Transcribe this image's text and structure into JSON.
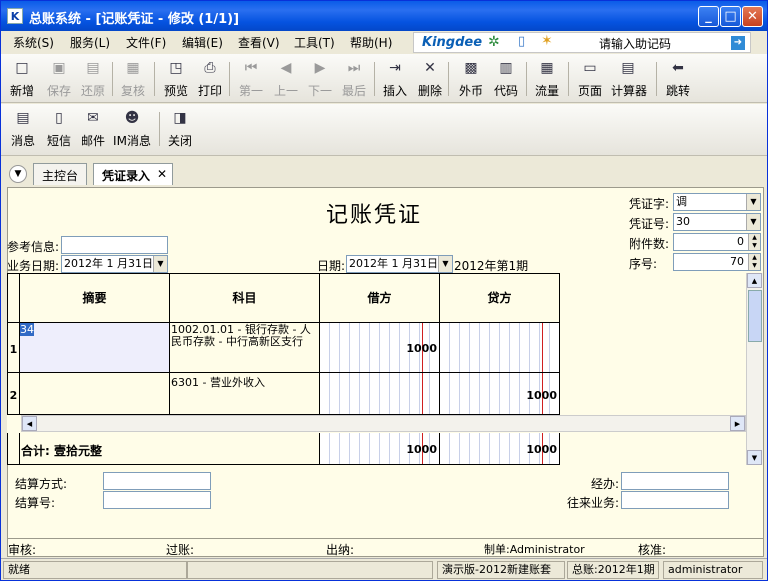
{
  "window": {
    "icon": "K",
    "title": "总账系统 - [记账凭证 - 修改 (1/1)]"
  },
  "menu": [
    "系统(S)",
    "服务(L)",
    "文件(F)",
    "编辑(E)",
    "查看(V)",
    "工具(T)",
    "帮助(H)"
  ],
  "brand": {
    "logo": "Kingdee",
    "hint": "请输入助记码"
  },
  "toolbar1": [
    {
      "label": "新增",
      "icon": "□",
      "enabled": true
    },
    {
      "label": "保存",
      "icon": "▣",
      "enabled": false
    },
    {
      "label": "还原",
      "icon": "▤",
      "enabled": false
    },
    {
      "label": "复核",
      "icon": "▦",
      "enabled": false
    },
    {
      "label": "预览",
      "icon": "◳",
      "enabled": true
    },
    {
      "label": "打印",
      "icon": "⎙",
      "enabled": true
    },
    {
      "label": "第一",
      "icon": "⏮",
      "enabled": false
    },
    {
      "label": "上一",
      "icon": "◀",
      "enabled": false
    },
    {
      "label": "下一",
      "icon": "▶",
      "enabled": false
    },
    {
      "label": "最后",
      "icon": "⏭",
      "enabled": false
    },
    {
      "label": "插入",
      "icon": "⇥",
      "enabled": true
    },
    {
      "label": "删除",
      "icon": "✕",
      "enabled": true
    },
    {
      "label": "外币",
      "icon": "▩",
      "enabled": true
    },
    {
      "label": "代码",
      "icon": "▥",
      "enabled": true
    },
    {
      "label": "流量",
      "icon": "▦",
      "enabled": true
    },
    {
      "label": "页面",
      "icon": "▭",
      "enabled": true
    },
    {
      "label": "计算器",
      "icon": "▤",
      "enabled": true
    },
    {
      "label": "跳转",
      "icon": "⬅",
      "enabled": true
    }
  ],
  "toolbar2": [
    {
      "label": "消息",
      "icon": "▤"
    },
    {
      "label": "短信",
      "icon": "▯"
    },
    {
      "label": "邮件",
      "icon": "✉"
    },
    {
      "label": "IM消息",
      "icon": "☻"
    },
    {
      "label": "关闭",
      "icon": "◨"
    }
  ],
  "tabs": [
    "主控台",
    "凭证录入"
  ],
  "voucher": {
    "title": "记账凭证",
    "ref_label": "参考信息:",
    "biz_date_label": "业务日期:",
    "biz_date": "2012年 1 月31日",
    "date_label": "日期:",
    "date": "2012年 1 月31日",
    "period": "2012年第1期",
    "word_label": "凭证字:",
    "word": "调",
    "number_label": "凭证号:",
    "number": "30",
    "attach_label": "附件数:",
    "attach": "0",
    "seq_label": "序号:",
    "seq": "70"
  },
  "grid": {
    "headers": [
      "摘要",
      "科目",
      "借方",
      "贷方"
    ],
    "rows": [
      {
        "no": "1",
        "summary": "34",
        "account": "1002.01.01 - 银行存款 - 人民币存款 - 中行高新区支行",
        "debit": "1000",
        "credit": ""
      },
      {
        "no": "2",
        "summary": "",
        "account": "6301 - 营业外收入",
        "debit": "",
        "credit": "1000"
      }
    ],
    "total_label": "合计: 壹拾元整",
    "total_debit": "1000",
    "total_credit": "1000"
  },
  "footer": {
    "settle_method": "结算方式:",
    "settle_no": "结算号:",
    "handler": "经办:",
    "partner": "往来业务:",
    "audit": "审核:",
    "post": "过账:",
    "cashier": "出纳:",
    "maker": "制单:Administrator",
    "checker": "核准:"
  },
  "status": {
    "ready": "就绪",
    "set": "演示版-2012新建账套",
    "period": "总账:2012年1期",
    "user": "administrator"
  }
}
